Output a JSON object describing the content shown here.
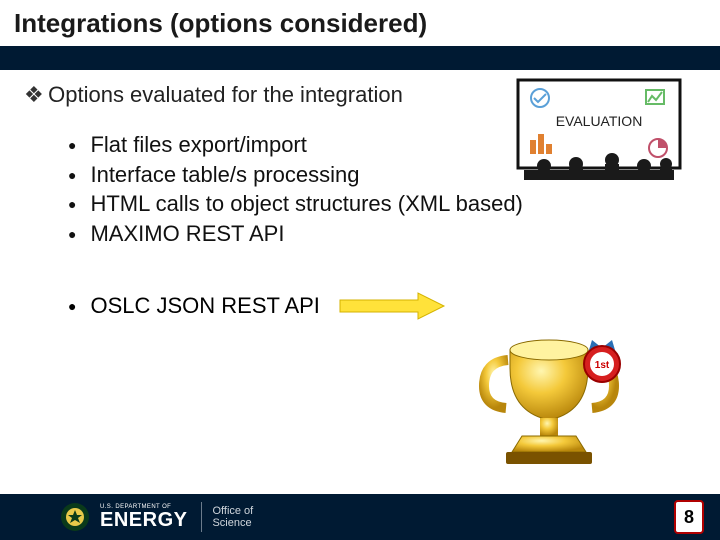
{
  "header": {
    "title": "Integrations (options considered)"
  },
  "lead_text": "Options evaluated for the integration",
  "options": [
    "Flat files export/import",
    "Interface table/s processing",
    "HTML calls to object structures (XML based)",
    "MAXIMO REST API"
  ],
  "winner": "OSLC JSON REST API",
  "footer": {
    "dept": "U.S. DEPARTMENT OF",
    "agency": "ENERGY",
    "office_l1": "Office of",
    "office_l2": "Science"
  },
  "page_number": "8",
  "badge_text": "1st",
  "illustration_label": "EVALUATION"
}
